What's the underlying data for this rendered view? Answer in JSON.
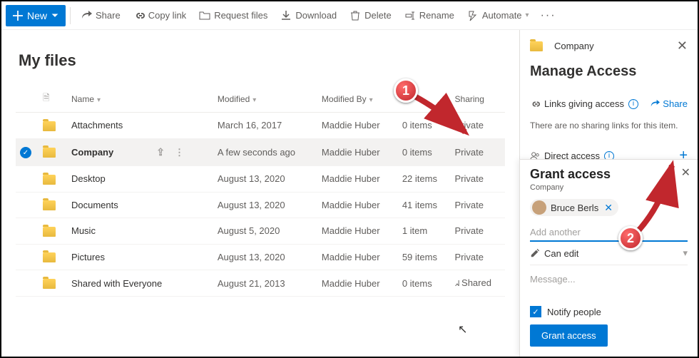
{
  "toolbar": {
    "new": "New",
    "share": "Share",
    "copylink": "Copy link",
    "request": "Request files",
    "download": "Download",
    "delete": "Delete",
    "rename": "Rename",
    "automate": "Automate"
  },
  "page_title": "My files",
  "columns": {
    "name": "Name",
    "modified": "Modified",
    "modified_by": "Modified By",
    "size": "",
    "sharing": "Sharing"
  },
  "rows": [
    {
      "name": "Attachments",
      "modified": "March 16, 2017",
      "by": "Maddie Huber",
      "size": "0 items",
      "sharing": "Private",
      "selected": false
    },
    {
      "name": "Company",
      "modified": "A few seconds ago",
      "by": "Maddie Huber",
      "size": "0 items",
      "sharing": "Private",
      "selected": true
    },
    {
      "name": "Desktop",
      "modified": "August 13, 2020",
      "by": "Maddie Huber",
      "size": "22 items",
      "sharing": "Private",
      "selected": false
    },
    {
      "name": "Documents",
      "modified": "August 13, 2020",
      "by": "Maddie Huber",
      "size": "41 items",
      "sharing": "Private",
      "selected": false
    },
    {
      "name": "Music",
      "modified": "August 5, 2020",
      "by": "Maddie Huber",
      "size": "1 item",
      "sharing": "Private",
      "selected": false
    },
    {
      "name": "Pictures",
      "modified": "August 13, 2020",
      "by": "Maddie Huber",
      "size": "59 items",
      "sharing": "Private",
      "selected": false
    },
    {
      "name": "Shared with Everyone",
      "modified": "August 21, 2013",
      "by": "Maddie Huber",
      "size": "0 items",
      "sharing": "Shared",
      "selected": false
    }
  ],
  "panel": {
    "folder": "Company",
    "title": "Manage Access",
    "links_section": "Links giving access",
    "share": "Share",
    "no_links": "There are no sharing links for this item.",
    "direct": "Direct access"
  },
  "grant": {
    "title": "Grant access",
    "subtitle": "Company",
    "chip_name": "Bruce Berls",
    "add_placeholder": "Add another",
    "permission": "Can edit",
    "message_placeholder": "Message...",
    "notify": "Notify people",
    "button": "Grant access"
  },
  "annotation": {
    "one": "1",
    "two": "2"
  }
}
